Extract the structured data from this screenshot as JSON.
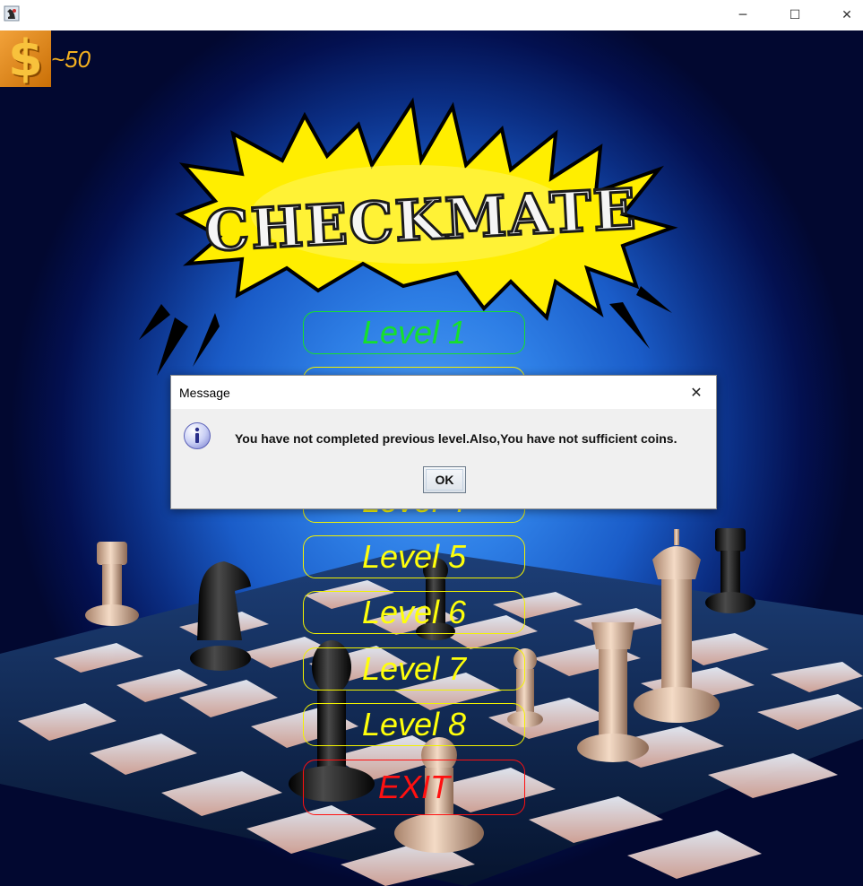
{
  "window": {
    "minimize_glyph": "─",
    "maximize_glyph": "☐",
    "close_glyph": "✕"
  },
  "coins": {
    "symbol": "$",
    "count": "~50"
  },
  "logo": {
    "text": "CHECKMATE"
  },
  "menu": {
    "level1": "Level 1",
    "level4": "Level 4",
    "level5": "Level 5",
    "level6": "Level 6",
    "level7": "Level 7",
    "level8": "Level 8",
    "exit": "EXIT"
  },
  "dialog": {
    "title": "Message",
    "close_glyph": "✕",
    "icon": "info-icon",
    "message": "You have not completed previous level.Also,You have not sufficient coins.",
    "ok_label": "OK"
  },
  "colors": {
    "level_unlocked": "#16e02c",
    "level_locked": "#ffff0a",
    "exit": "#ff1010",
    "coin_text": "#f3b020"
  }
}
